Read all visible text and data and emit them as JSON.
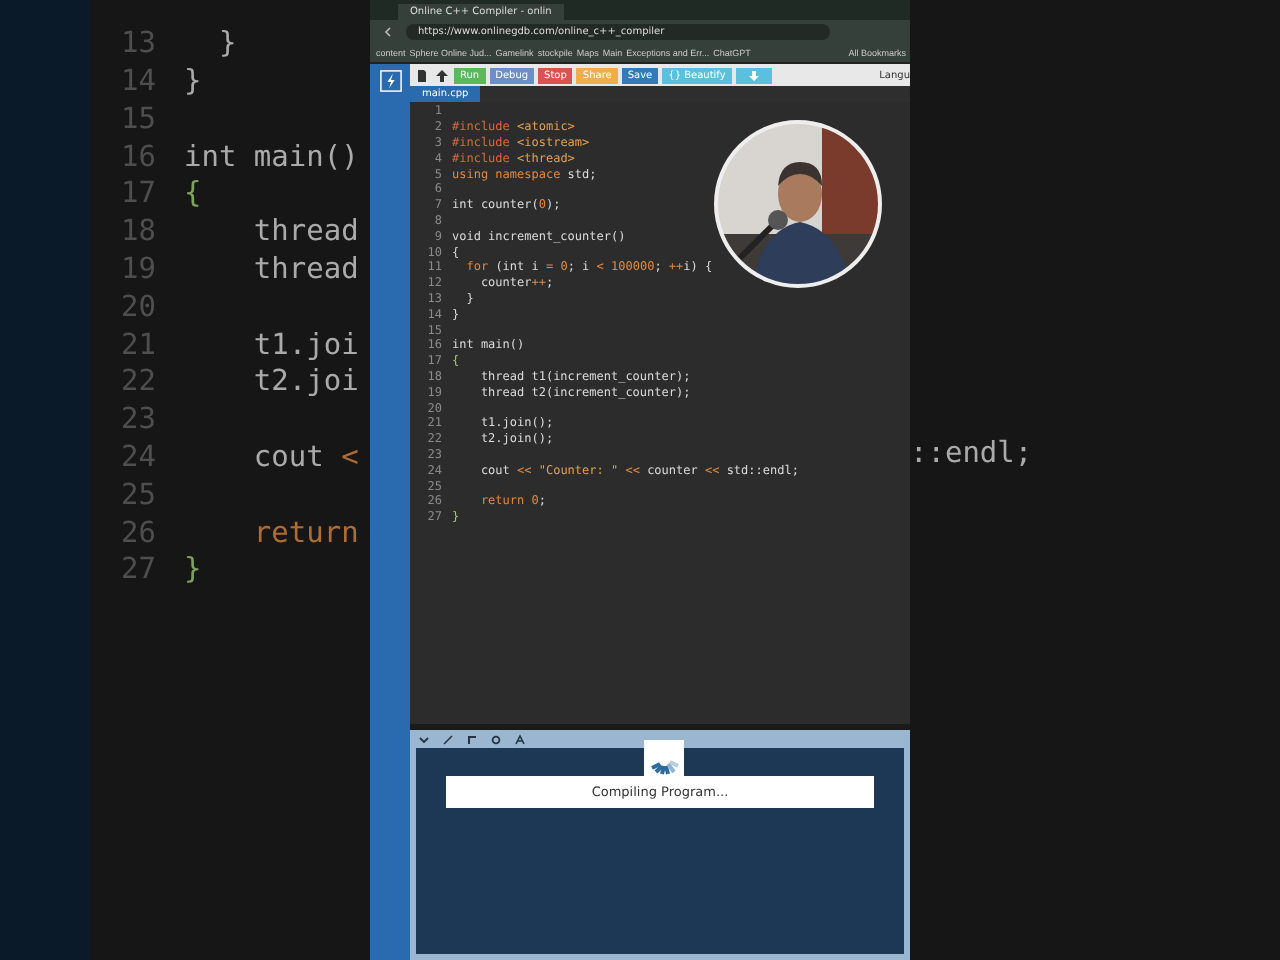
{
  "backdrop_left": [
    {
      "num": "13",
      "tokens": [
        {
          "text": "  }",
          "kind": "plain"
        }
      ]
    },
    {
      "num": "14",
      "tokens": [
        {
          "text": "}",
          "kind": "plain"
        }
      ]
    },
    {
      "num": "15"
    },
    {
      "num": "16",
      "tokens": [
        {
          "text": "int main()",
          "kind": "plain"
        }
      ]
    },
    {
      "num": "17",
      "tokens": [
        {
          "text": "{",
          "kind": "brace"
        }
      ]
    },
    {
      "num": "18",
      "tokens": [
        {
          "text": "    thread",
          "kind": "plain"
        }
      ]
    },
    {
      "num": "19",
      "tokens": [
        {
          "text": "    thread",
          "kind": "plain"
        }
      ]
    },
    {
      "num": "20"
    },
    {
      "num": "21",
      "tokens": [
        {
          "text": "    t1.joi",
          "kind": "plain"
        }
      ]
    },
    {
      "num": "22",
      "tokens": [
        {
          "text": "    t2.joi",
          "kind": "plain"
        }
      ]
    },
    {
      "num": "23"
    },
    {
      "num": "24",
      "tokens": [
        {
          "text": "    cout ",
          "kind": "plain"
        },
        {
          "text": "<",
          "kind": "operator"
        }
      ]
    },
    {
      "num": "25"
    },
    {
      "num": "26",
      "tokens": [
        {
          "text": "    return",
          "kind": "keyword"
        }
      ]
    },
    {
      "num": "27",
      "tokens": [
        {
          "text": "}",
          "kind": "brace"
        }
      ]
    }
  ],
  "backdrop_right": [
    {
      "text": "::endl;"
    }
  ],
  "browser": {
    "tab_title": "Online C++ Compiler - onlin",
    "url": "https://www.onlinegdb.com/online_c++_compiler",
    "bookmarks": [
      "content",
      "Sphere Online Jud...",
      "Gamelink",
      "stockpile",
      "Maps",
      "Main",
      "Exceptions and Err...",
      "ChatGPT"
    ],
    "all_bookmarks": "All Bookmarks"
  },
  "toolbar": {
    "buttons": [
      {
        "label": "Run",
        "kind": "run"
      },
      {
        "label": "Debug",
        "kind": "debug"
      },
      {
        "label": "Stop",
        "kind": "stop"
      },
      {
        "label": "Share",
        "kind": "share"
      },
      {
        "label": "Save",
        "kind": "save"
      },
      {
        "label": "{} Beautify",
        "kind": "beautify"
      }
    ],
    "language_label": "Langu"
  },
  "editor": {
    "tab": "main.cpp",
    "lines": [
      {
        "num": "1"
      },
      {
        "num": "2",
        "tokens": [
          {
            "text": "#include ",
            "kind": "preproc"
          },
          {
            "text": "<atomic>",
            "kind": "string"
          }
        ]
      },
      {
        "num": "3",
        "tokens": [
          {
            "text": "#include ",
            "kind": "preproc"
          },
          {
            "text": "<iostream>",
            "kind": "string"
          }
        ]
      },
      {
        "num": "4",
        "tokens": [
          {
            "text": "#include ",
            "kind": "preproc"
          },
          {
            "text": "<thread>",
            "kind": "string"
          }
        ]
      },
      {
        "num": "5",
        "tokens": [
          {
            "text": "using namespace ",
            "kind": "keyword"
          },
          {
            "text": "std;",
            "kind": "plain"
          }
        ]
      },
      {
        "num": "6"
      },
      {
        "num": "7",
        "tokens": [
          {
            "text": "int counter(",
            "kind": "plain"
          },
          {
            "text": "0",
            "kind": "number"
          },
          {
            "text": ");",
            "kind": "plain"
          }
        ]
      },
      {
        "num": "8"
      },
      {
        "num": "9",
        "tokens": [
          {
            "text": "void increment_counter()",
            "kind": "plain"
          }
        ]
      },
      {
        "num": "10",
        "tokens": [
          {
            "text": "{",
            "kind": "plain"
          }
        ]
      },
      {
        "num": "11",
        "tokens": [
          {
            "text": "  for ",
            "kind": "keyword"
          },
          {
            "text": "(int i ",
            "kind": "plain"
          },
          {
            "text": "= 0",
            "kind": "number"
          },
          {
            "text": "; i ",
            "kind": "plain"
          },
          {
            "text": "< 100000",
            "kind": "number"
          },
          {
            "text": "; ",
            "kind": "plain"
          },
          {
            "text": "++",
            "kind": "operator"
          },
          {
            "text": "i) {",
            "kind": "plain"
          }
        ]
      },
      {
        "num": "12",
        "tokens": [
          {
            "text": "    counter",
            "kind": "plain"
          },
          {
            "text": "++",
            "kind": "operator"
          },
          {
            "text": ";",
            "kind": "plain"
          }
        ]
      },
      {
        "num": "13",
        "tokens": [
          {
            "text": "  }",
            "kind": "plain"
          }
        ]
      },
      {
        "num": "14",
        "tokens": [
          {
            "text": "}",
            "kind": "plain"
          }
        ]
      },
      {
        "num": "15"
      },
      {
        "num": "16",
        "tokens": [
          {
            "text": "int main()",
            "kind": "plain"
          }
        ]
      },
      {
        "num": "17",
        "tokens": [
          {
            "text": "{",
            "kind": "brace"
          }
        ]
      },
      {
        "num": "18",
        "tokens": [
          {
            "text": "    thread t1(increment_counter);",
            "kind": "plain"
          }
        ]
      },
      {
        "num": "19",
        "tokens": [
          {
            "text": "    thread t2(increment_counter);",
            "kind": "plain"
          }
        ]
      },
      {
        "num": "20"
      },
      {
        "num": "21",
        "tokens": [
          {
            "text": "    t1.join();",
            "kind": "plain"
          }
        ]
      },
      {
        "num": "22",
        "tokens": [
          {
            "text": "    t2.join();",
            "kind": "plain"
          }
        ]
      },
      {
        "num": "23"
      },
      {
        "num": "24",
        "tokens": [
          {
            "text": "    cout ",
            "kind": "plain"
          },
          {
            "text": "<< ",
            "kind": "operator"
          },
          {
            "text": "\"Counter: \" ",
            "kind": "string"
          },
          {
            "text": "<< ",
            "kind": "operator"
          },
          {
            "text": "counter ",
            "kind": "plain"
          },
          {
            "text": "<< ",
            "kind": "operator"
          },
          {
            "text": "std::endl;",
            "kind": "plain"
          }
        ]
      },
      {
        "num": "25"
      },
      {
        "num": "26",
        "tokens": [
          {
            "text": "    return ",
            "kind": "keyword"
          },
          {
            "text": "0",
            "kind": "number"
          },
          {
            "text": ";",
            "kind": "plain"
          }
        ]
      },
      {
        "num": "27",
        "tokens": [
          {
            "text": "}",
            "kind": "brace"
          }
        ]
      }
    ]
  },
  "output": {
    "message": "Compiling Program..."
  }
}
